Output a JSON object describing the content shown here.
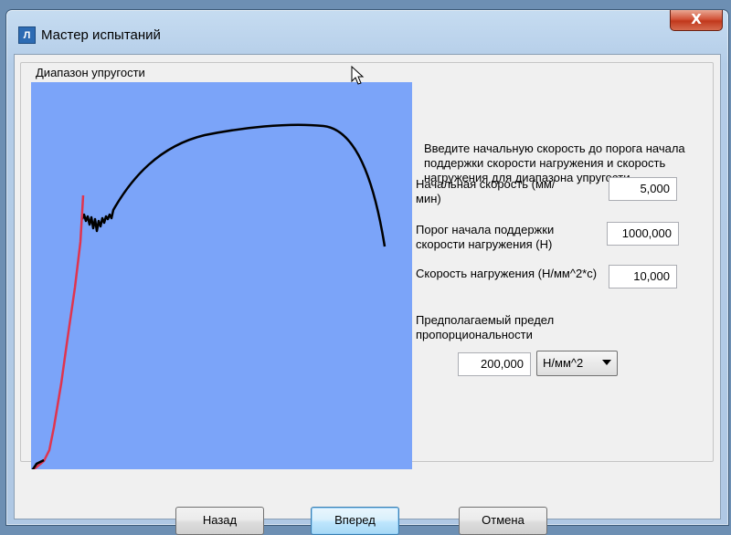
{
  "window": {
    "title": "Мастер испытаний",
    "icon_text": "Л",
    "close_symbol": "X"
  },
  "group": {
    "title": "Диапазон упругости"
  },
  "description": "Введите начальную скорость до порога начала поддержки скорости нагружения и скорость нагружения для диапазона упругости",
  "fields": {
    "start_speed": {
      "label": "Начальная скорость (мм/мин)",
      "value": "5,000"
    },
    "threshold": {
      "label": "Порог начала поддержки скорости нагружения (Н)",
      "value": "1000,000"
    },
    "load_rate": {
      "label": "Скорость нагружения (Н/мм^2*с)",
      "value": "10,000"
    },
    "proportional_limit": {
      "label": "Предполагаемый предел пропорциональности",
      "value": "200,000",
      "unit": "Н/мм^2"
    }
  },
  "buttons": {
    "back": "Назад",
    "next": "Вперед",
    "cancel": "Отмена"
  },
  "colors": {
    "chart_background": "#7ba4f9",
    "curve_plastic": "#000000",
    "curve_elastic": "#e0344e"
  }
}
